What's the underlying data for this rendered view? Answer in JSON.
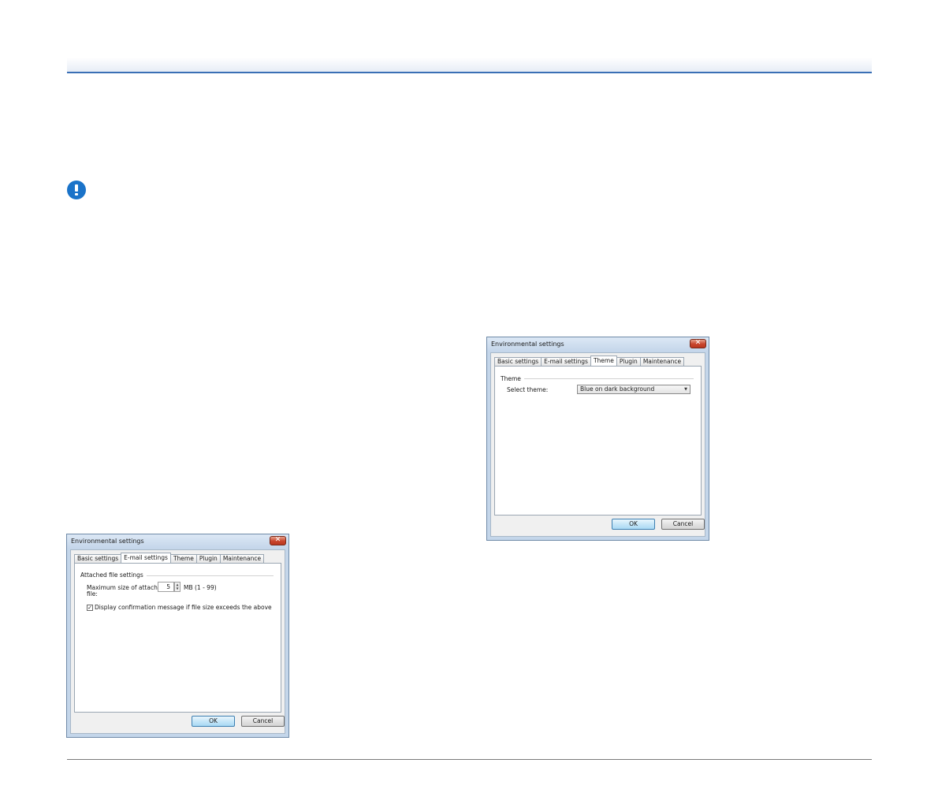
{
  "page": {
    "icons": {
      "important": "exclamation-circle-icon"
    },
    "accent_color": "#3a6fb5"
  },
  "email_dialog": {
    "title": "Environmental settings",
    "close_label": "✕",
    "tabs": [
      "Basic settings",
      "E-mail settings",
      "Theme",
      "Plugin",
      "Maintenance"
    ],
    "active_tab": "E-mail settings",
    "group_label": "Attached file settings",
    "max_size_label_line1": "Maximum size of attached",
    "max_size_label_line2": "file:",
    "max_size_value": "5",
    "max_size_unit": "MB (1 - 99)",
    "confirm_checked": true,
    "confirm_label": "Display confirmation message if file size exceeds the above",
    "ok_label": "OK",
    "cancel_label": "Cancel"
  },
  "theme_dialog": {
    "title": "Environmental settings",
    "close_label": "✕",
    "tabs": [
      "Basic settings",
      "E-mail settings",
      "Theme",
      "Plugin",
      "Maintenance"
    ],
    "active_tab": "Theme",
    "group_label": "Theme",
    "select_theme_label": "Select theme:",
    "selected_theme": "Blue on dark background",
    "ok_label": "OK",
    "cancel_label": "Cancel"
  }
}
